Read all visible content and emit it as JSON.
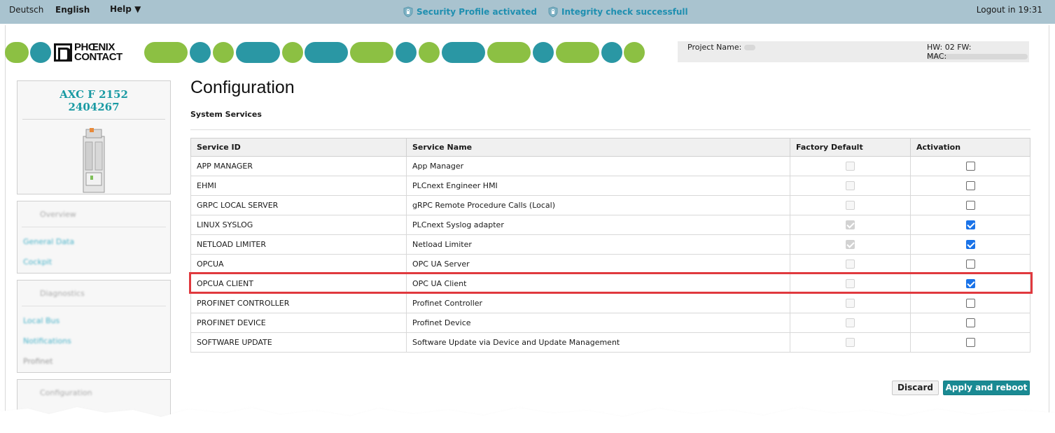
{
  "topbar": {
    "lang_de": "Deutsch",
    "lang_en": "English",
    "help": "Help ▼",
    "security_status": "Security Profile activated",
    "integrity_status": "Integrity check successfull",
    "logout": "Logout in 19:31"
  },
  "header": {
    "logo_line1": "PHŒNIX",
    "logo_line2": "CONTACT",
    "project_label": "Project Name:",
    "hw_fw_label": "HW: 02 FW:",
    "mac_label": "MAC:"
  },
  "device": {
    "model": "AXC F 2152",
    "article": "2404267"
  },
  "sidebar": {
    "overview": {
      "title": "Overview",
      "items": [
        "General Data",
        "Cockpit"
      ]
    },
    "diagnostics": {
      "title": "Diagnostics",
      "items": [
        "Local Bus",
        "Notifications",
        "Profinet"
      ]
    },
    "configuration": {
      "title": "Configuration"
    }
  },
  "main": {
    "title": "Configuration",
    "subtitle": "System Services",
    "columns": [
      "Service ID",
      "Service Name",
      "Factory Default",
      "Activation"
    ],
    "rows": [
      {
        "id": "APP MANAGER",
        "name": "App Manager",
        "factory": false,
        "active": false
      },
      {
        "id": "EHMI",
        "name": "PLCnext Engineer HMI",
        "factory": false,
        "active": false
      },
      {
        "id": "GRPC LOCAL SERVER",
        "name": "gRPC Remote Procedure Calls (Local)",
        "factory": false,
        "active": false
      },
      {
        "id": "LINUX SYSLOG",
        "name": "PLCnext Syslog adapter",
        "factory": true,
        "active": true
      },
      {
        "id": "NETLOAD LIMITER",
        "name": "Netload Limiter",
        "factory": true,
        "active": true
      },
      {
        "id": "OPCUA",
        "name": "OPC UA Server",
        "factory": false,
        "active": false
      },
      {
        "id": "OPCUA CLIENT",
        "name": "OPC UA Client",
        "factory": false,
        "active": true
      },
      {
        "id": "PROFINET CONTROLLER",
        "name": "Profinet Controller",
        "factory": false,
        "active": false
      },
      {
        "id": "PROFINET DEVICE",
        "name": "Profinet Device",
        "factory": false,
        "active": false
      },
      {
        "id": "SOFTWARE UPDATE",
        "name": "Software Update via Device and Update Management",
        "factory": false,
        "active": false
      }
    ],
    "discard_label": "Discard",
    "apply_label": "Apply and reboot"
  },
  "colors": {
    "topbar": "#a9c3cf",
    "accent_teal": "#1a8a93",
    "pill_green": "#8cc043",
    "pill_teal": "#2a97a4",
    "highlight": "#e0393e",
    "checkbox_on": "#1a73e8"
  }
}
